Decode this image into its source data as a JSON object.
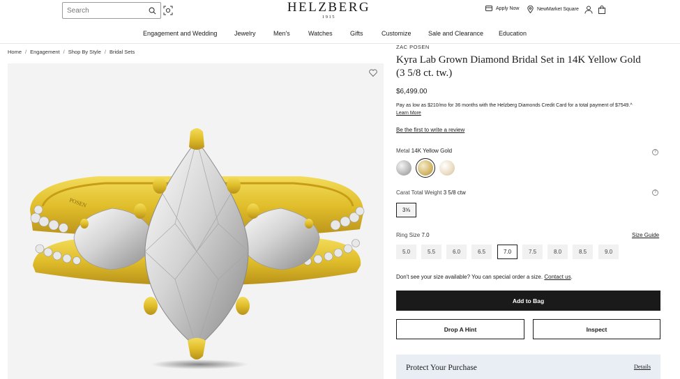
{
  "header": {
    "search_placeholder": "Search",
    "logo_word": "HELZBERG",
    "logo_year": "1915",
    "apply_now": "Apply Now",
    "store": "NewMarket Square"
  },
  "nav": {
    "items": [
      "Engagement and Wedding",
      "Jewelry",
      "Men's",
      "Watches",
      "Gifts",
      "Customize",
      "Sale and Clearance",
      "Education"
    ]
  },
  "breadcrumb": [
    "Home",
    "Engagement",
    "Shop By Style",
    "Bridal Sets"
  ],
  "product": {
    "brand": "ZAC POSEN",
    "title": "Kyra Lab Grown Diamond Bridal Set in 14K Yellow Gold (3 5/8 ct. tw.)",
    "price": "$6,499.00",
    "finance_text": "Pay as low as $210/mo for 36 months with the Helzberg Diamonds Credit Card for a total payment of $7549.^",
    "learn_more": "Learn More",
    "review_link": "Be the first to write a review",
    "band_engraving": "POSEN"
  },
  "metal": {
    "label": "Metal",
    "value": "14K Yellow Gold",
    "swatches": [
      {
        "name": "white-gold",
        "color": "#c9c9c9"
      },
      {
        "name": "yellow-gold",
        "color": "#d8c48a",
        "selected": true
      },
      {
        "name": "rose-gold",
        "color": "#e8dcc6"
      }
    ]
  },
  "carat": {
    "label": "Carat Total Weight",
    "value": "3 5/8 ctw",
    "option": "3⅝"
  },
  "ring_size": {
    "label": "Ring Size",
    "value": "7.0",
    "guide": "Size Guide",
    "options": [
      "5.0",
      "5.5",
      "6.0",
      "6.5",
      "7.0",
      "7.5",
      "8.0",
      "8.5",
      "9.0"
    ],
    "selected": "7.0"
  },
  "special_order": {
    "text": "Don't see your size available? You can special order a size.",
    "link": "Contact us",
    "end": "."
  },
  "actions": {
    "add_to_bag": "Add to Bag",
    "drop_hint": "Drop A Hint",
    "inspect": "Inspect"
  },
  "protect": {
    "title": "Protect Your Purchase",
    "details": "Details"
  },
  "colors": {
    "dark": "#1a1a1a",
    "protect_bg": "#e9eef5",
    "gallery_bg": "#f3f3f3",
    "gold": "#e6c733"
  }
}
